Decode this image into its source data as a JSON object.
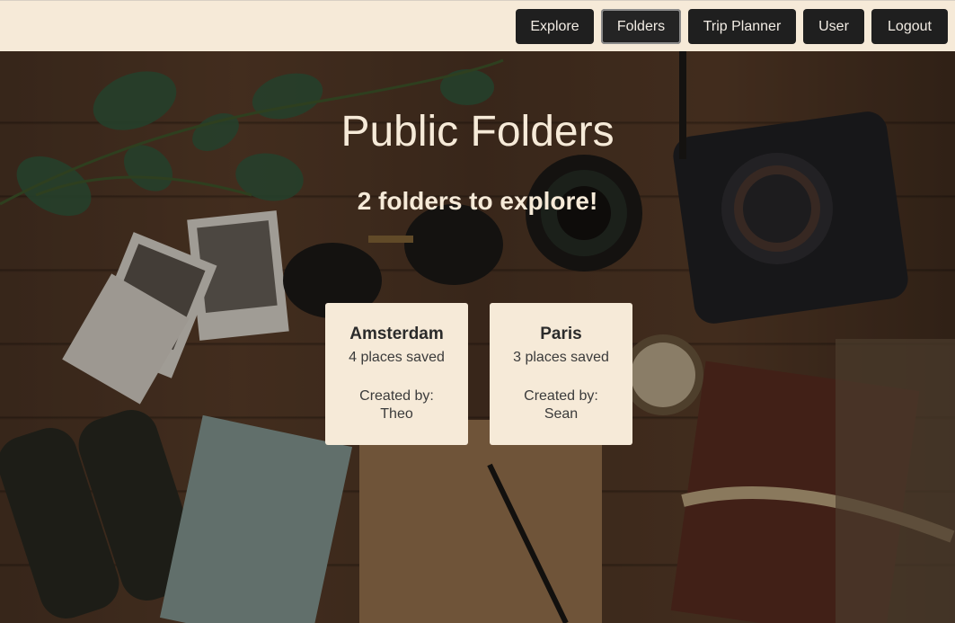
{
  "nav": {
    "items": [
      {
        "label": "Explore"
      },
      {
        "label": "Folders"
      },
      {
        "label": "Trip Planner"
      },
      {
        "label": "User"
      },
      {
        "label": "Logout"
      }
    ]
  },
  "main": {
    "title": "Public Folders",
    "subtitle": "2 folders to explore!",
    "folders": [
      {
        "name": "Amsterdam",
        "count": "4 places saved",
        "created_label": "Created by:",
        "creator": "Theo"
      },
      {
        "name": "Paris",
        "count": "3 places saved",
        "created_label": "Created by:",
        "creator": "Sean"
      }
    ]
  },
  "colors": {
    "navbar_bg": "#f6ead8",
    "button_bg": "#1f1f1f",
    "card_bg": "#f6ead8",
    "title_text": "#f6ead8"
  }
}
